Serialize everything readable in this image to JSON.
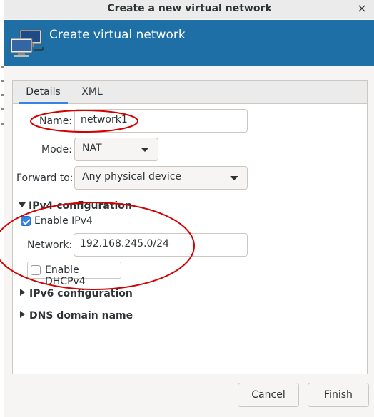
{
  "window": {
    "title": "Create a new virtual network",
    "close_glyph": "×"
  },
  "banner": {
    "title": "Create virtual network",
    "icon": "network-computers-icon"
  },
  "tabs": [
    {
      "label": "Details",
      "active": true
    },
    {
      "label": "XML",
      "active": false
    }
  ],
  "form": {
    "name_label": "Name:",
    "name_value": "network1",
    "mode_label": "Mode:",
    "mode_value": "NAT",
    "forward_label": "Forward to:",
    "forward_value": "Any physical device"
  },
  "ipv4": {
    "header": "IPv4 configuration",
    "expanded": true,
    "enable_label": "Enable IPv4",
    "enable_checked": true,
    "network_label": "Network:",
    "network_value": "192.168.245.0/24",
    "dhcp_label": "Enable DHCPv4",
    "dhcp_checked": false
  },
  "ipv6": {
    "header": "IPv6 configuration",
    "expanded": false
  },
  "dns": {
    "header": "DNS domain name",
    "expanded": false
  },
  "buttons": {
    "cancel": "Cancel",
    "finish": "Finish"
  },
  "colors": {
    "banner": "#1d6fa5",
    "accent": "#3584e4",
    "annotation": "#d40000"
  }
}
